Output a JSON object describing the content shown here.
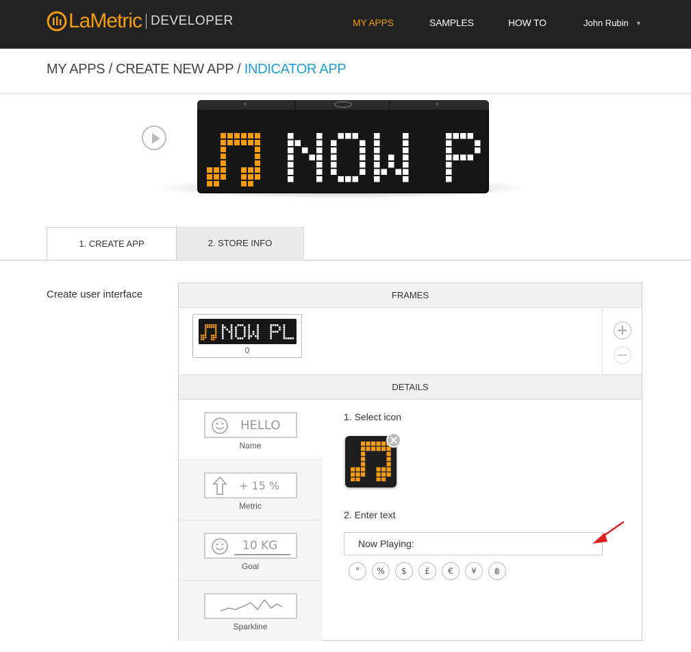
{
  "header": {
    "logo_text": "LaMetric",
    "logo_sub": "DEVELOPER",
    "nav": [
      {
        "label": "MY APPS",
        "active": true
      },
      {
        "label": "SAMPLES",
        "active": false
      },
      {
        "label": "HOW TO",
        "active": false
      }
    ],
    "user_name": "John Rubin",
    "accent_color": "#f39c12"
  },
  "breadcrumb": {
    "part1": "MY APPS",
    "sep1": " / ",
    "part2": "CREATE NEW APP",
    "sep2": " / ",
    "current": "INDICATOR APP",
    "current_color": "#1e9ed9"
  },
  "preview": {
    "display_text": "NOW PLI",
    "icon": "music-note-icon",
    "play_icon": "play-icon"
  },
  "tabs": [
    {
      "label": "1. CREATE APP",
      "active": true
    },
    {
      "label": "2. STORE INFO",
      "active": false
    }
  ],
  "section_label": "Create user interface",
  "frames": {
    "heading": "FRAMES",
    "items": [
      {
        "text": "NOW PLI",
        "index": "0"
      }
    ]
  },
  "details": {
    "heading": "DETAILS",
    "widgets": [
      {
        "box_text": "HELLO",
        "caption": "Name",
        "icon": "smiley-icon"
      },
      {
        "box_text": "+ 15 %",
        "caption": "Metric",
        "icon": "arrow-up-icon"
      },
      {
        "box_text": "10 KG",
        "caption": "Goal",
        "icon": "smiley-icon"
      },
      {
        "box_text": "",
        "caption": "Sparkline",
        "icon": "sparkline-icon"
      }
    ],
    "step1_label": "1. Select icon",
    "step2_label": "2. Enter text",
    "text_value": "Now Playing:",
    "symbols": [
      "°",
      "%",
      "$",
      "£",
      "€",
      "¥",
      "฿"
    ]
  }
}
